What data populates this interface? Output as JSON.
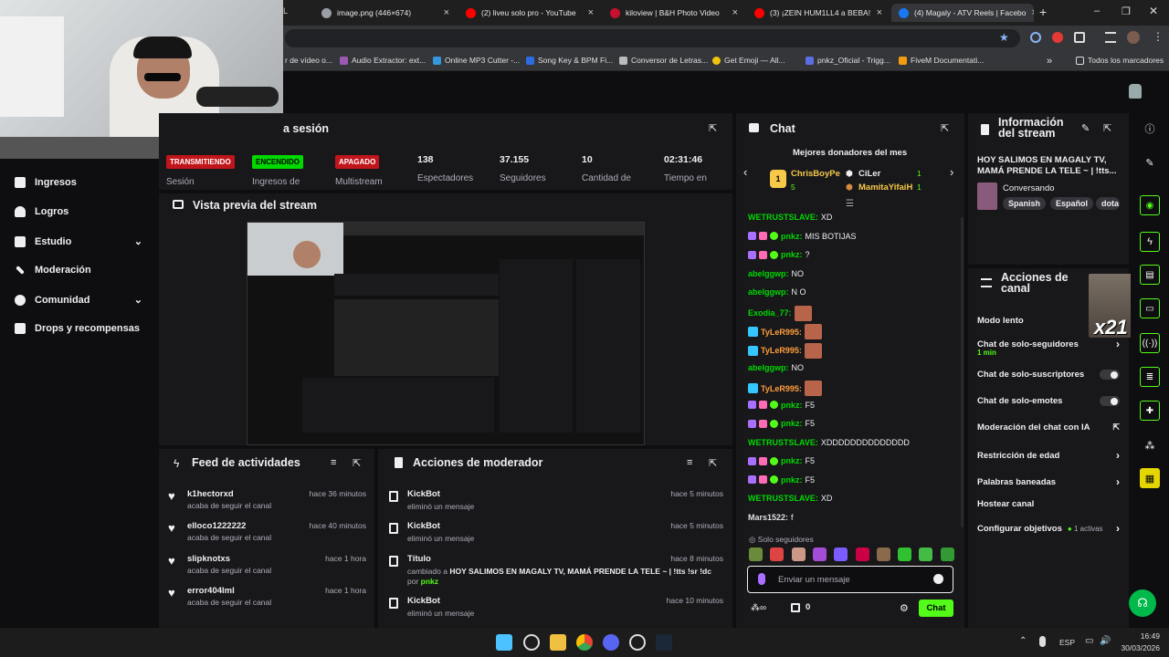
{
  "browser": {
    "tabs": [
      {
        "title": "image.png (446×674)",
        "fav": "#9aa0a6"
      },
      {
        "title": "(2) liveu solo pro - YouTube",
        "fav": "#ff0000"
      },
      {
        "title": "kiloview | B&H Photo Video",
        "fav": "#c8102e"
      },
      {
        "title": "(3) ¡ZEIN HUM1LL4 a BEBA!",
        "fav": "#ff0000"
      },
      {
        "title": "(4) Magaly - ATV Reels | Facebo",
        "fav": "#1877f2"
      }
    ],
    "partial_tab": "L",
    "bookmarks": [
      {
        "label": "r de vídeo o...",
        "color": "#e0e0e0"
      },
      {
        "label": "Audio Extractor: ext...",
        "color": "#9b59b6"
      },
      {
        "label": "Online MP3 Cutter -...",
        "color": "#3498db"
      },
      {
        "label": "Song Key & BPM Fi...",
        "color": "#2d6cdf"
      },
      {
        "label": "Conversor de Letras...",
        "color": "#bbbbbb"
      },
      {
        "label": "Get Emoji — All...",
        "color": "#f1c40f"
      },
      {
        "label": "pnkz_Oficial - Trigg...",
        "color": "#5b6ee1"
      },
      {
        "label": "FiveM Documentati...",
        "color": "#f39c12"
      }
    ],
    "all_bookmarks": "Todos los marcadores",
    "overflow": "»"
  },
  "session": {
    "title_partial": "a sesión",
    "statuses": [
      {
        "label": "TRANSMITIENDO",
        "caption": "Sesión",
        "bg": "#c0161b",
        "fg": "#ffffff"
      },
      {
        "label": "ENCENDIDO",
        "caption": "Ingresos de",
        "bg": "#00d900",
        "fg": "#000000"
      },
      {
        "label": "APAGADO",
        "caption": "Multistream",
        "bg": "#c0161b",
        "fg": "#ffffff"
      }
    ],
    "stats": [
      {
        "value": "138",
        "label": "Espectadores"
      },
      {
        "value": "37.155",
        "label": "Seguidores"
      },
      {
        "value": "10",
        "label": "Cantidad de"
      },
      {
        "value": "02:31:46",
        "label": "Tiempo en"
      }
    ]
  },
  "sidebar": {
    "items": [
      {
        "label": "Ingresos",
        "icon": "bank-icon"
      },
      {
        "label": "Logros",
        "icon": "trophy-icon"
      },
      {
        "label": "Estudio",
        "icon": "grid-icon"
      },
      {
        "label": "Moderación",
        "icon": "wrench-icon"
      },
      {
        "label": "Comunidad",
        "icon": "people-icon"
      },
      {
        "label": "Drops y recompensas",
        "icon": "gift-icon"
      }
    ]
  },
  "preview": {
    "title": "Vista previa del stream"
  },
  "feed": {
    "title": "Feed de actividades",
    "items": [
      {
        "user": "k1hectorxd",
        "action": "acaba de seguir el canal",
        "time": "hace 36 minutos"
      },
      {
        "user": "elloco1222222",
        "action": "acaba de seguir el canal",
        "time": "hace 40 minutos"
      },
      {
        "user": "slipknotxs",
        "action": "acaba de seguir el canal",
        "time": "hace 1 hora"
      },
      {
        "user": "error404lml",
        "action": "acaba de seguir el canal",
        "time": "hace 1 hora"
      }
    ]
  },
  "modactions": {
    "title": "Acciones de moderador",
    "items": [
      {
        "user": "KickBot",
        "action": "eliminó un mensaje",
        "time": "hace 5 minutos"
      },
      {
        "user": "KickBot",
        "action": "eliminó un mensaje",
        "time": "hace 5 minutos"
      },
      {
        "user": "Título",
        "action": "cambiado a",
        "bold": "HOY SALIMOS EN MAGALY TV, MAMÁ PRENDE LA TELE ~ | !tts !sr !dc",
        "by": "por",
        "byuser": "pnkz",
        "time": "hace 8 minutos"
      },
      {
        "user": "KickBot",
        "action": "eliminó un mensaje",
        "time": "hace 10 minutos"
      }
    ]
  },
  "chat": {
    "title": "Chat",
    "donors_title": "Mejores donadores del mes",
    "donors": [
      {
        "name": "ChrisBoyPe",
        "count": "5"
      },
      {
        "name": "CiLer",
        "count": "1"
      },
      {
        "name": "MamitaYifaiH",
        "count": "1"
      }
    ],
    "messages": [
      {
        "user": "WETRUSTSLAVE:",
        "text": "XD",
        "color": "#00d900",
        "badges": 0
      },
      {
        "user": "pnkz:",
        "text": "MIS BOTIJAS",
        "color": "#00d900",
        "badges": 3
      },
      {
        "user": "pnkz:",
        "text": "?",
        "color": "#00d900",
        "badges": 3
      },
      {
        "user": "abelggwp:",
        "text": "NO",
        "color": "#00d900",
        "badges": 0
      },
      {
        "user": "abelggwp:",
        "text": "N O",
        "color": "#00d900",
        "badges": 0
      },
      {
        "user": "Exodia_77:",
        "text": "",
        "color": "#00d900",
        "badges": 0,
        "emote": true
      },
      {
        "user": "TyLeR995:",
        "text": "",
        "color": "#ff9d3c",
        "badges": 1,
        "emote": true
      },
      {
        "user": "TyLeR995:",
        "text": "",
        "color": "#ff9d3c",
        "badges": 1,
        "emote": true
      },
      {
        "user": "abelggwp:",
        "text": "NO",
        "color": "#00d900",
        "badges": 0
      },
      {
        "user": "TyLeR995:",
        "text": "",
        "color": "#ff9d3c",
        "badges": 1,
        "emote": true
      },
      {
        "user": "pnkz:",
        "text": "F5",
        "color": "#00d900",
        "badges": 3
      },
      {
        "user": "pnkz:",
        "text": "F5",
        "color": "#00d900",
        "badges": 3
      },
      {
        "user": "WETRUSTSLAVE:",
        "text": "XDDDDDDDDDDDDDD",
        "color": "#00d900",
        "badges": 0
      },
      {
        "user": "pnkz:",
        "text": "F5",
        "color": "#00d900",
        "badges": 3
      },
      {
        "user": "pnkz:",
        "text": "F5",
        "color": "#00d900",
        "badges": 3
      },
      {
        "user": "WETRUSTSLAVE:",
        "text": "XD",
        "color": "#00d900",
        "badges": 0
      },
      {
        "user": "Mars1522:",
        "text": "f",
        "color": "#e0e0e0",
        "badges": 0
      }
    ],
    "followers_only": "Solo seguidores",
    "placeholder": "Enviar un mensaje",
    "viewers": "0",
    "send_label": "Chat"
  },
  "info": {
    "title": "Información del stream",
    "stream_title": "HOY SALIMOS EN MAGALY TV, MAMÁ PRENDE LA TELE ~ | !tts...",
    "category": "Conversando",
    "tags": [
      "Spanish",
      "Español",
      "dota"
    ]
  },
  "actions": {
    "title": "Acciones de canal",
    "overlay": "x21",
    "rows": [
      {
        "label": "Modo lento",
        "type": "plain"
      },
      {
        "label": "Chat de solo-seguidores",
        "sub": "1 min",
        "type": "chev"
      },
      {
        "label": "Chat de solo-suscriptores",
        "type": "toggle"
      },
      {
        "label": "Chat de solo-emotes",
        "type": "toggle"
      },
      {
        "label": "Moderación del chat con IA",
        "type": "ext"
      },
      {
        "label": "Restricción de edad",
        "type": "chev"
      },
      {
        "label": "Palabras baneadas",
        "type": "chev"
      },
      {
        "label": "Hostear canal",
        "type": "plain"
      },
      {
        "label": "Configurar objetivos",
        "extra": "1 activas",
        "type": "chev"
      }
    ]
  },
  "taskbar": {
    "lang": "ESP",
    "time": "16:49",
    "date": "30/03/2026"
  },
  "colors": {
    "accent": "#53fc18",
    "bg": "#0e0e10",
    "panel": "#18181b"
  }
}
